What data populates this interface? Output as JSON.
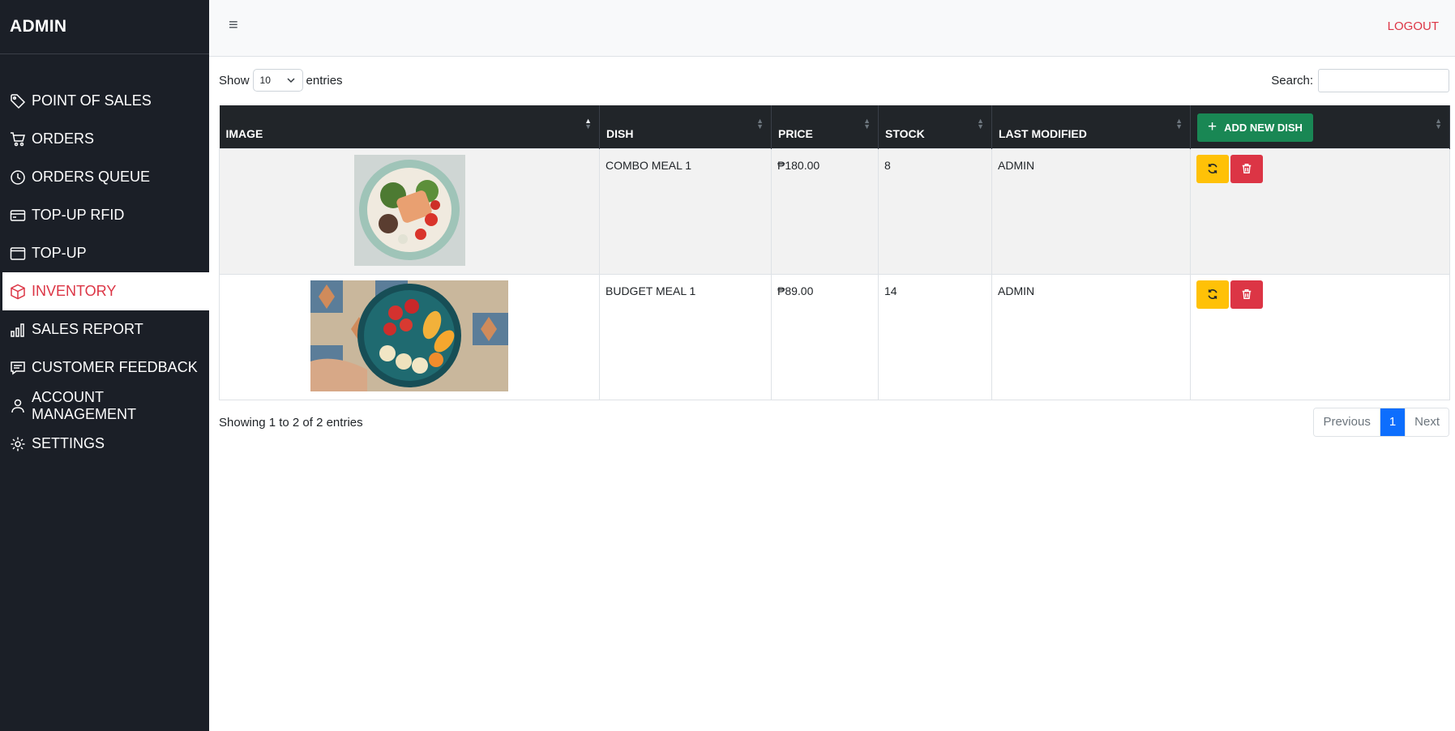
{
  "sidebar": {
    "brand": "ADMIN",
    "items": [
      {
        "label": "POINT OF SALES",
        "icon": "tag-icon"
      },
      {
        "label": "ORDERS",
        "icon": "cart-icon"
      },
      {
        "label": "ORDERS QUEUE",
        "icon": "clock-icon"
      },
      {
        "label": "TOP-UP RFID",
        "icon": "credit-card-icon"
      },
      {
        "label": "TOP-UP",
        "icon": "window-icon"
      },
      {
        "label": "INVENTORY",
        "icon": "box-icon",
        "active": true
      },
      {
        "label": "SALES REPORT",
        "icon": "bar-chart-icon"
      },
      {
        "label": "CUSTOMER FEEDBACK",
        "icon": "chat-icon"
      },
      {
        "label": "ACCOUNT MANAGEMENT",
        "icon": "person-icon"
      },
      {
        "label": "SETTINGS",
        "icon": "gear-icon"
      }
    ]
  },
  "topbar": {
    "menu_icon": "≡",
    "logout": "LOGOUT"
  },
  "controls": {
    "show_label": "Show",
    "entries_value": "10",
    "entries_label": "entries",
    "search_label": "Search:",
    "search_value": ""
  },
  "table": {
    "headers": [
      "IMAGE",
      "DISH",
      "PRICE",
      "STOCK",
      "LAST MODIFIED"
    ],
    "add_button": "ADD NEW DISH",
    "rows": [
      {
        "dish": "COMBO MEAL 1",
        "price": "₱180.00",
        "stock": "8",
        "modified": "ADMIN",
        "image": "salad-bowl"
      },
      {
        "dish": "BUDGET MEAL 1",
        "price": "₱89.00",
        "stock": "14",
        "modified": "ADMIN",
        "image": "fruit-bowl"
      }
    ]
  },
  "footer": {
    "info": "Showing 1 to 2 of 2 entries",
    "previous": "Previous",
    "page": "1",
    "next": "Next"
  },
  "colors": {
    "sidebar_bg": "#1b1f27",
    "active": "#dc3545",
    "add": "#198754",
    "update": "#ffc107",
    "delete": "#dc3545",
    "page": "#0d6efd"
  }
}
